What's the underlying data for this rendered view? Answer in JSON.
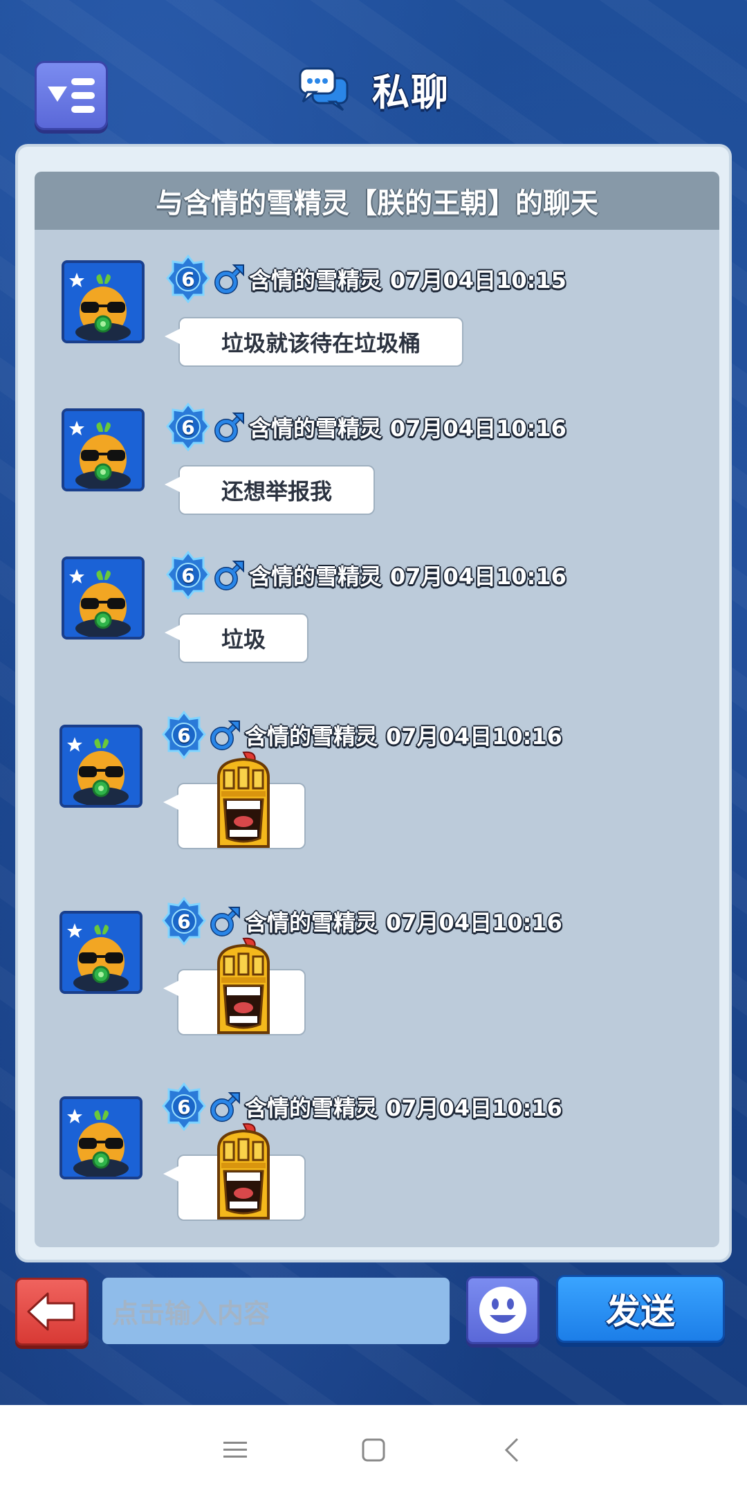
{
  "header": {
    "title": "私聊"
  },
  "chat": {
    "title": "与含情的雪精灵【朕的王朝】的聊天",
    "messages": [
      {
        "level": "6",
        "nickname": "含情的雪精灵",
        "time": "07月04日10:15",
        "type": "text",
        "text": "垃圾就该待在垃圾桶"
      },
      {
        "level": "6",
        "nickname": "含情的雪精灵",
        "time": "07月04日10:16",
        "type": "text",
        "text": "还想举报我"
      },
      {
        "level": "6",
        "nickname": "含情的雪精灵",
        "time": "07月04日10:16",
        "type": "text",
        "text": "垃圾"
      },
      {
        "level": "6",
        "nickname": "含情的雪精灵",
        "time": "07月04日10:16",
        "type": "sticker",
        "sticker": "laughing-knight-sticker"
      },
      {
        "level": "6",
        "nickname": "含情的雪精灵",
        "time": "07月04日10:16",
        "type": "sticker",
        "sticker": "laughing-knight-sticker"
      },
      {
        "level": "6",
        "nickname": "含情的雪精灵",
        "time": "07月04日10:16",
        "type": "sticker",
        "sticker": "laughing-knight-sticker"
      }
    ]
  },
  "input": {
    "placeholder": "点击输入内容",
    "send_label": "发送"
  },
  "icons": {
    "menu": "menu-filter-icon",
    "chat": "chat-bubbles-icon",
    "back": "back-arrow-icon",
    "emoji": "smiley-icon",
    "gender": "male-icon",
    "level": "level-star-badge-icon"
  },
  "colors": {
    "background": "#1b468e",
    "send_button": "#1c7ee8",
    "back_button": "#d83a35",
    "emoji_button": "#5a68d8"
  }
}
